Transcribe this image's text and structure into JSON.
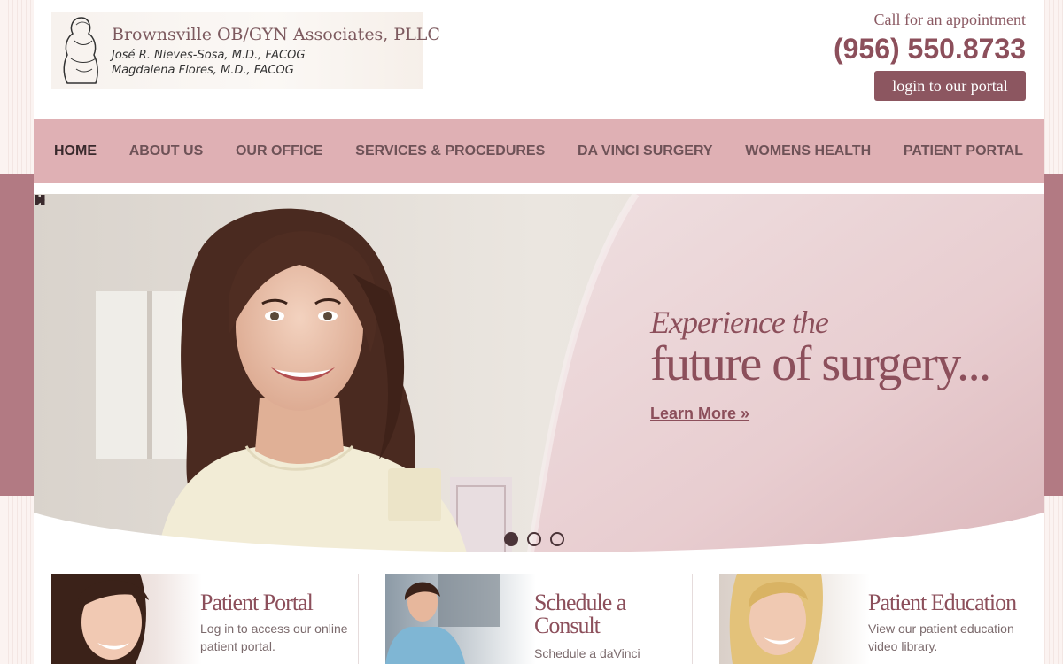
{
  "header": {
    "logo": {
      "title": "Brownsville OB/GYN Associates, PLLC",
      "doctor_1": "José R. Nieves-Sosa, M.D., FACOG",
      "doctor_2": "Magdalena Flores, M.D., FACOG"
    },
    "call_text": "Call for an appointment",
    "phone": "(956) 550.8733",
    "portal_button": "login to our portal"
  },
  "nav": {
    "items": [
      {
        "label": "HOME",
        "active": true
      },
      {
        "label": "ABOUT US"
      },
      {
        "label": "OUR OFFICE"
      },
      {
        "label": "SERVICES & PROCEDURES"
      },
      {
        "label": "DA VINCI SURGERY"
      },
      {
        "label": "WOMENS HEALTH"
      },
      {
        "label": "PATIENT PORTAL"
      }
    ]
  },
  "hero": {
    "line_1": "Experience the",
    "line_2": "future of surgery...",
    "link": "Learn More »",
    "controls": {
      "play_icon": "play-icon",
      "pause_icon": "pause-icon"
    },
    "slides_total": 3,
    "active_slide": 1
  },
  "cards": [
    {
      "title": "Patient Portal",
      "text": "Log in to access our online patient portal."
    },
    {
      "title": "Schedule a Consult",
      "text": "Schedule a daVinci"
    },
    {
      "title": "Patient Education",
      "text": "View our patient education video library."
    }
  ],
  "colors": {
    "brand": "#8c4f5b",
    "nav_bg": "#dfb0b4",
    "band": "#b27a83",
    "nav_text": "#6e5257"
  }
}
